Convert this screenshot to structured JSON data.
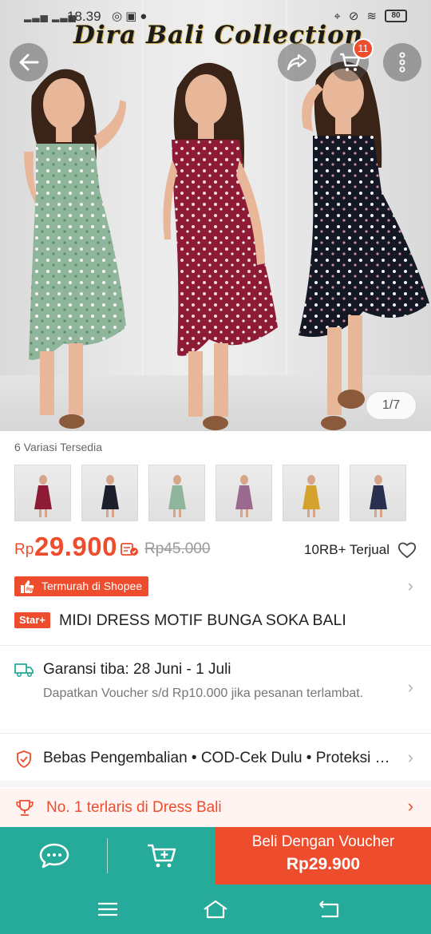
{
  "status_bar": {
    "time": "18.39",
    "battery": "80"
  },
  "header": {
    "brand_watermark": "Dira Bali Collection",
    "cart_count": "11"
  },
  "gallery": {
    "counter": "1/7"
  },
  "variations": {
    "label": "6 Variasi Tersedia",
    "thumbs": [
      "red floral dress",
      "black floral dress",
      "green floral dress",
      "purple floral dress",
      "mustard floral dress",
      "navy floral dress"
    ]
  },
  "price": {
    "currency": "Rp",
    "current": "29.900",
    "original": "Rp45.000",
    "sold": "10RB+ Terjual"
  },
  "promo": {
    "cheapest_label": "Termurah di Shopee"
  },
  "product": {
    "badge": "Star+",
    "title": "MIDI DRESS MOTIF BUNGA SOKA BALI"
  },
  "shipping": {
    "title": "Garansi tiba: 28 Juni - 1 Juli",
    "subtitle": "Dapatkan Voucher s/d Rp10.000 jika pesanan terlambat."
  },
  "returns": {
    "text": "Bebas Pengembalian  •  COD-Cek Dulu  •  Proteksi Kerusakan"
  },
  "best_seller": {
    "text": "No. 1 terlaris di Dress Bali"
  },
  "action_bar": {
    "buy_label": "Beli Dengan Voucher",
    "buy_price": "Rp29.900"
  },
  "colors": {
    "brand_orange": "#ee4d2d",
    "teal": "#26aa99"
  }
}
